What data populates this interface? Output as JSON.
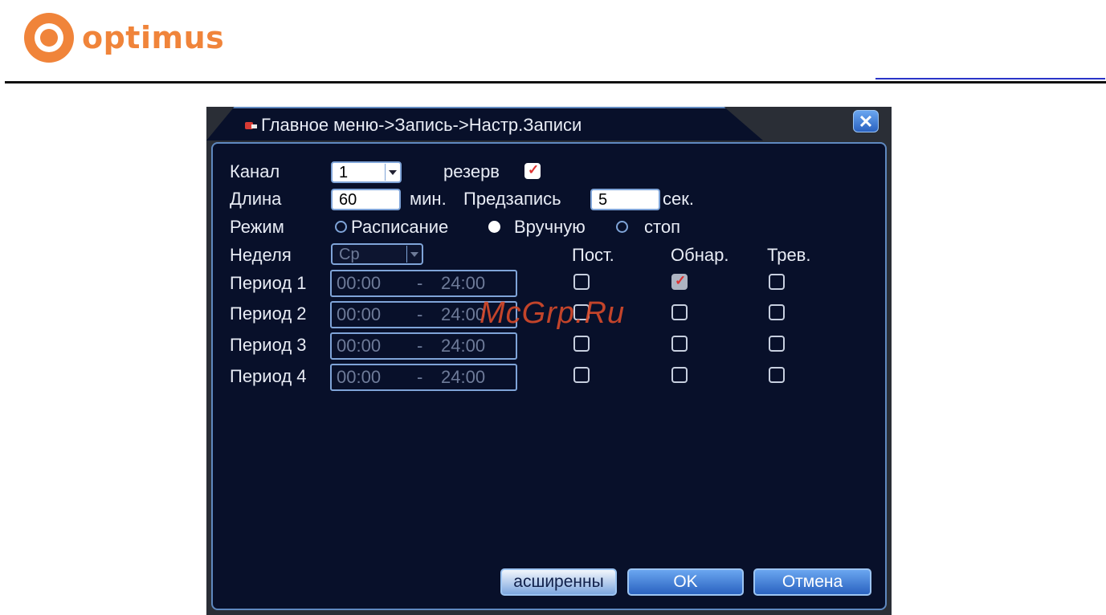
{
  "brand": {
    "name": "optimus",
    "color": "#f0843a",
    "icon": "optimus-logo-icon"
  },
  "dialog": {
    "title": "Главное меню->Запись->Настр.Записи",
    "close_icon": "close-icon",
    "channel": {
      "label": "Канал",
      "value": "1"
    },
    "backup": {
      "label": "резерв",
      "checked": true
    },
    "length": {
      "label": "Длина",
      "value": "60",
      "unit": "мин."
    },
    "prerecord": {
      "label": "Предзапись",
      "value": "5",
      "unit": "сек."
    },
    "mode": {
      "label": "Режим",
      "options": [
        "Расписание",
        "Вручную",
        "стоп"
      ],
      "selected": "Вручную"
    },
    "week": {
      "label": "Неделя",
      "value": "Ср"
    },
    "columns": [
      "Пост.",
      "Обнар.",
      "Трев."
    ],
    "periods": [
      {
        "label": "Период 1",
        "from": "00:00",
        "dash": "-",
        "to": "24:00",
        "regular": false,
        "detect": true,
        "alarm": false
      },
      {
        "label": "Период 2",
        "from": "00:00",
        "dash": "-",
        "to": "24:00",
        "regular": false,
        "detect": false,
        "alarm": false
      },
      {
        "label": "Период 3",
        "from": "00:00",
        "dash": "-",
        "to": "24:00",
        "regular": false,
        "detect": false,
        "alarm": false
      },
      {
        "label": "Период 4",
        "from": "00:00",
        "dash": "-",
        "to": "24:00",
        "regular": false,
        "detect": false,
        "alarm": false
      }
    ],
    "buttons": {
      "advanced": "асширенны",
      "ok": "OK",
      "cancel": "Отмена"
    }
  },
  "watermark": "McGrp.Ru"
}
